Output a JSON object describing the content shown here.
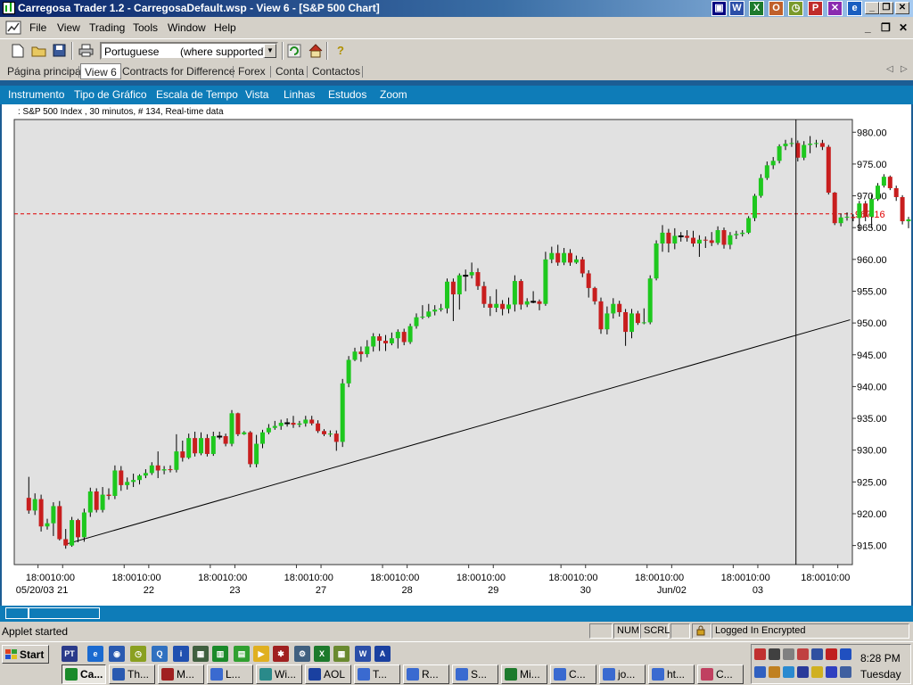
{
  "window": {
    "title": "Carregosa Trader 1.2 - CarregosaDefault.wsp - View 6 - [S&P 500 Chart]",
    "title_tray_icons": [
      "word-icon",
      "excel-icon",
      "outlook-icon",
      "clock-icon",
      "powerpoint-icon",
      "close-app-icon",
      "ie-icon"
    ]
  },
  "menubar": {
    "items": [
      "File",
      "View",
      "Trading",
      "Tools",
      "Window",
      "Help"
    ]
  },
  "toolbar": {
    "language_value": "Portuguese",
    "language_note": "(where supported)"
  },
  "tabs": {
    "items": [
      "Página principal",
      "View 6",
      "Contracts for Difference",
      "Forex",
      "Conta",
      "Contactos"
    ],
    "active": "View 6"
  },
  "app_menu": {
    "items": [
      "Instrumento",
      "Tipo de Gráfico",
      "Escala de Tempo",
      "Vista",
      "Linhas",
      "Estudos",
      "Zoom"
    ]
  },
  "chart_header": {
    "text": ": S&P 500 Index , 30 minutos, # 134, Real-time data"
  },
  "chart_data": {
    "type": "candlestick",
    "instrument": "S&P 500 Index",
    "interval": "30 minutos",
    "ylim": [
      912,
      982
    ],
    "y_ticks": [
      "980.00",
      "975.00",
      "970.00",
      "965.00",
      "960.00",
      "955.00",
      "950.00",
      "945.00",
      "940.00",
      "935.00",
      "930.00",
      "925.00",
      "920.00",
      "915.00"
    ],
    "current_price": "967.16",
    "up_color": "#1ec81e",
    "down_color": "#c81e1e",
    "price_line_color": "#e00000",
    "x_time_labels": [
      {
        "i": 1.5,
        "t": "18:00"
      },
      {
        "i": 5.5,
        "t": "10:00"
      },
      {
        "i": 15.5,
        "t": "18:00"
      },
      {
        "i": 19.5,
        "t": "10:00"
      },
      {
        "i": 29.5,
        "t": "18:00"
      },
      {
        "i": 33.5,
        "t": "10:00"
      },
      {
        "i": 43.5,
        "t": "18:00"
      },
      {
        "i": 47.5,
        "t": "10:00"
      },
      {
        "i": 57.5,
        "t": "18:00"
      },
      {
        "i": 61.5,
        "t": "10:00"
      },
      {
        "i": 71.5,
        "t": "18:00"
      },
      {
        "i": 75.5,
        "t": "10:00"
      },
      {
        "i": 86.5,
        "t": "18:00"
      },
      {
        "i": 90.5,
        "t": "10:00"
      },
      {
        "i": 100.5,
        "t": "18:00"
      },
      {
        "i": 104.5,
        "t": "10:00"
      },
      {
        "i": 114.5,
        "t": "18:00"
      },
      {
        "i": 118.5,
        "t": "10:00"
      },
      {
        "i": 127.5,
        "t": "18:00"
      },
      {
        "i": 131.5,
        "t": "10:00"
      }
    ],
    "x_date_labels": [
      {
        "i": 1.0,
        "t": "05/20/03"
      },
      {
        "i": 5.5,
        "t": "21"
      },
      {
        "i": 19.5,
        "t": "22"
      },
      {
        "i": 33.5,
        "t": "23"
      },
      {
        "i": 47.5,
        "t": "27"
      },
      {
        "i": 61.5,
        "t": "28"
      },
      {
        "i": 75.5,
        "t": "29"
      },
      {
        "i": 90.5,
        "t": "30"
      },
      {
        "i": 104.5,
        "t": "Jun/02"
      },
      {
        "i": 118.5,
        "t": "03"
      }
    ],
    "trendline": {
      "from": {
        "i": 6,
        "v": 915.2
      },
      "to": {
        "i": 133.5,
        "v": 950.5
      }
    },
    "cursor_index": 124.7,
    "candles": [
      [
        922.5,
        920.5,
        925.8,
        920.0
      ],
      [
        920.5,
        922.3,
        923.2,
        919.8
      ],
      [
        922.3,
        918.0,
        923.0,
        917.2
      ],
      [
        918.0,
        918.5,
        919.2,
        917.5
      ],
      [
        918.5,
        921.2,
        921.8,
        916.5
      ],
      [
        921.2,
        916.0,
        922.0,
        915.8
      ],
      [
        916.0,
        915.0,
        917.6,
        914.5
      ],
      [
        915.0,
        919.0,
        919.5,
        914.8
      ],
      [
        919.0,
        916.3,
        919.2,
        915.5
      ],
      [
        916.3,
        920.2,
        920.8,
        915.6
      ],
      [
        920.2,
        923.5,
        924.1,
        919.5
      ],
      [
        923.5,
        920.6,
        924.0,
        920.2
      ],
      [
        920.6,
        923.0,
        924.2,
        920.2
      ],
      [
        923.0,
        922.8,
        924.0,
        922.2
      ],
      [
        922.8,
        926.8,
        927.6,
        922.3
      ],
      [
        926.8,
        924.5,
        927.5,
        923.6
      ],
      [
        924.5,
        925.0,
        925.7,
        923.8
      ],
      [
        925.0,
        925.3,
        926.3,
        924.2
      ],
      [
        925.3,
        926.0,
        926.2,
        924.6
      ],
      [
        926.0,
        926.4,
        927.0,
        925.6
      ],
      [
        926.4,
        927.6,
        928.1,
        926.1
      ],
      [
        927.6,
        926.8,
        929.8,
        925.6
      ],
      [
        926.8,
        927.0,
        927.5,
        926.2
      ],
      [
        927.0,
        926.9,
        927.6,
        926.5
      ],
      [
        926.9,
        929.8,
        932.5,
        926.5
      ],
      [
        929.8,
        928.8,
        931.5,
        928.2
      ],
      [
        928.8,
        931.9,
        932.6,
        928.6
      ],
      [
        931.9,
        929.5,
        932.9,
        929.0
      ],
      [
        929.5,
        931.9,
        932.8,
        929.2
      ],
      [
        931.9,
        929.4,
        932.5,
        929.0
      ],
      [
        929.4,
        932.2,
        932.9,
        929.1
      ],
      [
        932.2,
        932.2,
        932.9,
        931.7
      ],
      [
        932.2,
        931.0,
        932.6,
        930.6
      ],
      [
        931.0,
        935.8,
        936.3,
        930.6
      ],
      [
        935.8,
        932.5,
        935.9,
        932.2
      ],
      [
        932.5,
        932.8,
        933.0,
        932.4
      ],
      [
        932.8,
        927.8,
        933.0,
        927.3
      ],
      [
        927.8,
        931.0,
        932.4,
        927.3
      ],
      [
        931.0,
        932.8,
        933.2,
        930.3
      ],
      [
        932.8,
        933.5,
        934.1,
        932.5
      ],
      [
        933.5,
        933.8,
        934.6,
        933.2
      ],
      [
        933.8,
        934.3,
        934.8,
        933.2
      ],
      [
        934.3,
        934.3,
        935.0,
        933.7
      ],
      [
        934.3,
        934.0,
        935.4,
        933.5
      ],
      [
        934.0,
        934.2,
        934.6,
        933.6
      ],
      [
        934.2,
        934.8,
        935.4,
        933.7
      ],
      [
        934.8,
        934.2,
        935.4,
        933.9
      ],
      [
        934.2,
        933.0,
        934.7,
        932.7
      ],
      [
        933.0,
        932.5,
        933.3,
        932.2
      ],
      [
        932.5,
        932.6,
        933.1,
        932.1
      ],
      [
        932.6,
        931.3,
        933.1,
        929.9
      ],
      [
        931.3,
        940.5,
        941.2,
        930.5
      ],
      [
        940.5,
        944.2,
        944.8,
        939.9
      ],
      [
        944.2,
        945.5,
        946.1,
        944.0
      ],
      [
        945.5,
        945.1,
        946.3,
        943.9
      ],
      [
        945.1,
        946.3,
        947.3,
        944.6
      ],
      [
        946.3,
        947.9,
        948.4,
        945.5
      ],
      [
        947.9,
        947.2,
        948.3,
        945.6
      ],
      [
        947.2,
        946.8,
        948.1,
        945.6
      ],
      [
        946.8,
        947.6,
        948.5,
        946.5
      ],
      [
        947.6,
        948.6,
        949.0,
        946.0
      ],
      [
        948.6,
        947.0,
        949.1,
        946.5
      ],
      [
        947.0,
        949.5,
        949.9,
        946.7
      ],
      [
        949.5,
        950.9,
        951.5,
        949.1
      ],
      [
        950.9,
        951.0,
        952.8,
        950.6
      ],
      [
        951.0,
        951.8,
        953.0,
        950.8
      ],
      [
        951.8,
        952.1,
        952.8,
        951.2
      ],
      [
        952.1,
        952.3,
        953.0,
        951.8
      ],
      [
        952.3,
        956.5,
        957.0,
        951.5
      ],
      [
        956.5,
        954.5,
        957.0,
        950.3
      ],
      [
        954.5,
        957.5,
        957.8,
        952.1
      ],
      [
        957.5,
        957.5,
        958.4,
        955.0
      ],
      [
        957.5,
        958.0,
        959.5,
        957.0
      ],
      [
        958.0,
        955.8,
        958.6,
        955.2
      ],
      [
        955.8,
        953.0,
        956.5,
        952.4
      ],
      [
        953.0,
        952.4,
        954.2,
        951.1
      ],
      [
        952.4,
        953.0,
        955.3,
        951.7
      ],
      [
        953.0,
        952.2,
        953.6,
        951.2
      ],
      [
        952.2,
        952.9,
        954.0,
        951.5
      ],
      [
        952.9,
        956.6,
        957.5,
        951.8
      ],
      [
        956.6,
        952.9,
        956.9,
        952.1
      ],
      [
        952.9,
        953.4,
        953.9,
        952.5
      ],
      [
        953.4,
        953.4,
        955.0,
        953.1
      ],
      [
        953.4,
        953.0,
        953.7,
        952.0
      ],
      [
        953.0,
        960.0,
        961.2,
        952.7
      ],
      [
        960.0,
        961.0,
        962.0,
        959.4
      ],
      [
        961.0,
        959.5,
        962.3,
        959.0
      ],
      [
        959.5,
        961.0,
        961.8,
        959.1
      ],
      [
        961.0,
        959.5,
        961.6,
        959.0
      ],
      [
        959.5,
        960.0,
        960.6,
        959.3
      ],
      [
        960.0,
        957.8,
        960.4,
        957.2
      ],
      [
        957.8,
        955.5,
        958.3,
        954.0
      ],
      [
        955.5,
        953.4,
        955.7,
        952.9
      ],
      [
        953.4,
        949.0,
        954.0,
        948.3
      ],
      [
        949.0,
        951.5,
        952.6,
        948.2
      ],
      [
        951.5,
        953.0,
        953.9,
        950.7
      ],
      [
        953.0,
        951.7,
        953.5,
        951.0
      ],
      [
        951.7,
        948.6,
        952.2,
        946.4
      ],
      [
        948.6,
        951.5,
        952.2,
        947.6
      ],
      [
        951.5,
        950.0,
        951.9,
        949.7
      ],
      [
        950.0,
        950.1,
        952.3,
        949.8
      ],
      [
        950.1,
        957.0,
        957.5,
        949.8
      ],
      [
        957.0,
        962.5,
        963.0,
        956.7
      ],
      [
        962.5,
        964.2,
        965.4,
        961.2
      ],
      [
        964.2,
        962.5,
        964.8,
        961.1
      ],
      [
        962.5,
        963.7,
        964.9,
        961.6
      ],
      [
        963.7,
        963.7,
        964.3,
        962.8
      ],
      [
        963.7,
        963.4,
        964.6,
        962.8
      ],
      [
        963.4,
        962.5,
        964.5,
        962.0
      ],
      [
        962.5,
        963.1,
        963.8,
        960.4
      ],
      [
        963.1,
        963.0,
        963.6,
        961.8
      ],
      [
        963.0,
        962.6,
        964.3,
        962.1
      ],
      [
        962.6,
        964.6,
        965.2,
        962.3
      ],
      [
        964.6,
        962.3,
        965.0,
        961.7
      ],
      [
        962.3,
        963.8,
        964.3,
        961.6
      ],
      [
        963.8,
        964.0,
        964.5,
        963.2
      ],
      [
        964.0,
        964.2,
        964.6,
        963.6
      ],
      [
        964.2,
        966.5,
        966.8,
        964.0
      ],
      [
        966.5,
        970.0,
        970.3,
        966.0
      ],
      [
        970.0,
        972.8,
        973.4,
        969.7
      ],
      [
        972.8,
        974.8,
        975.4,
        972.5
      ],
      [
        974.8,
        975.5,
        976.1,
        974.2
      ],
      [
        975.5,
        977.8,
        978.1,
        975.1
      ],
      [
        977.8,
        978.2,
        978.8,
        977.2
      ],
      [
        978.2,
        978.3,
        979.1,
        977.7
      ],
      [
        978.3,
        976.0,
        978.7,
        975.4
      ],
      [
        976.0,
        978.0,
        978.6,
        975.6
      ],
      [
        978.0,
        978.2,
        979.4,
        976.7
      ],
      [
        978.2,
        978.3,
        978.8,
        977.6
      ],
      [
        978.3,
        977.7,
        978.8,
        977.2
      ],
      [
        977.7,
        970.5,
        978.0,
        970.2
      ],
      [
        970.5,
        965.7,
        970.6,
        965.4
      ],
      [
        965.7,
        966.6,
        967.2,
        965.2
      ],
      [
        966.6,
        966.7,
        967.4,
        966.1
      ],
      [
        966.7,
        966.5,
        967.1,
        966.0
      ],
      [
        966.5,
        968.8,
        969.2,
        964.6
      ],
      [
        968.8,
        966.7,
        969.2,
        966.0
      ],
      [
        966.7,
        969.5,
        970.2,
        964.9
      ],
      [
        969.5,
        971.6,
        972.0,
        969.2
      ],
      [
        971.6,
        973.0,
        973.4,
        971.3
      ],
      [
        973.0,
        971.2,
        973.2,
        970.9
      ],
      [
        971.2,
        969.8,
        971.6,
        969.2
      ],
      [
        969.8,
        966.0,
        970.1,
        965.5
      ],
      [
        966.0,
        966.3,
        966.7,
        964.9
      ],
      [
        966.3,
        966.0,
        967.0,
        964.6
      ],
      [
        966.0,
        967.3,
        967.7,
        965.3
      ]
    ]
  },
  "status": {
    "message": "Applet started",
    "num": "NUM",
    "scrl": "SCRL",
    "login": "Logged In Encrypted"
  },
  "taskbar": {
    "start_label": "Start",
    "tasks": [
      "Ca...",
      "Th...",
      "M...",
      "L...",
      "Wi...",
      "AOL",
      "T...",
      "R...",
      "S...",
      "Mi...",
      "C...",
      "jo...",
      "ht...",
      "C..."
    ],
    "time": "8:28 PM",
    "day": "Tuesday"
  }
}
